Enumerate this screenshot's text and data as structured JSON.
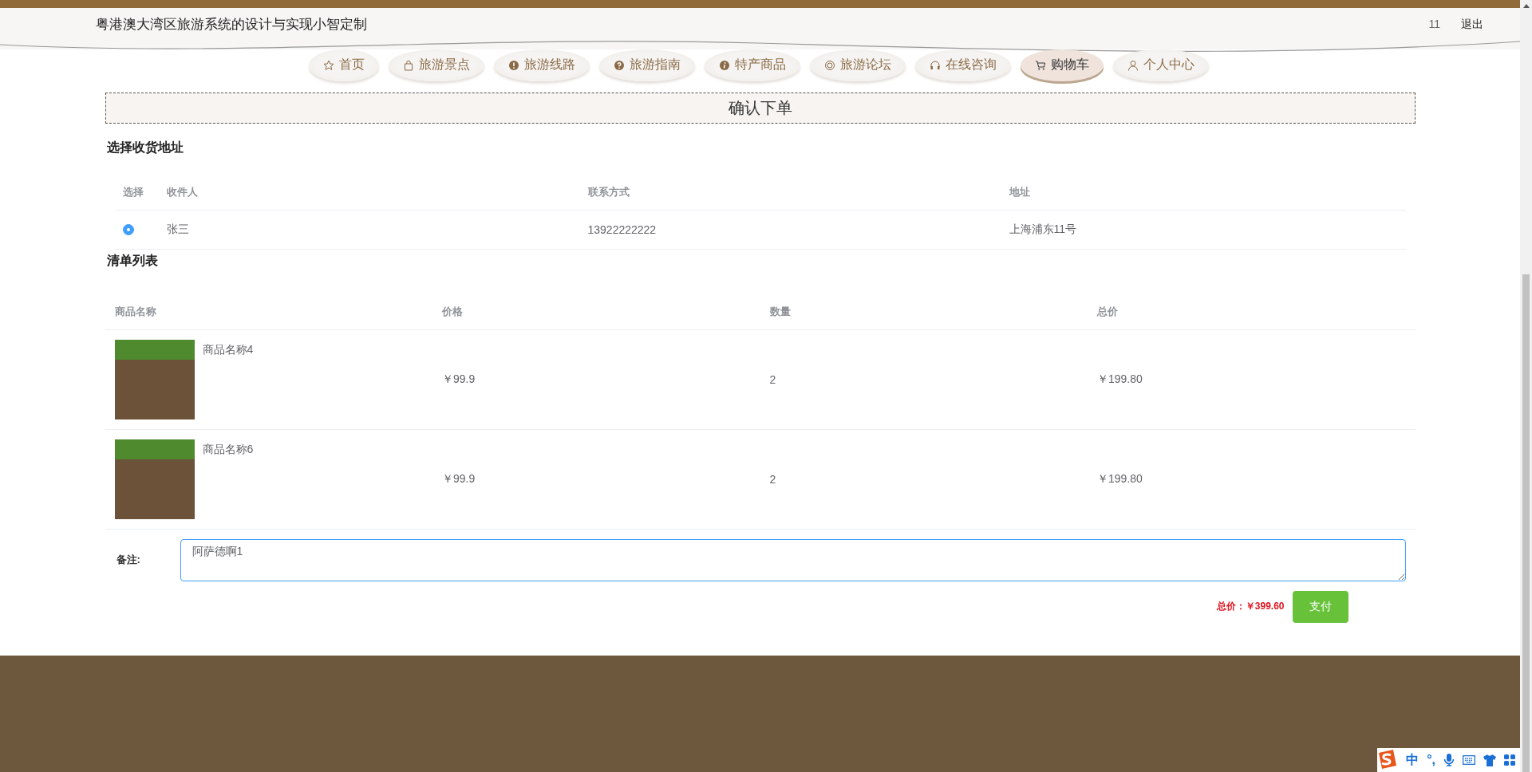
{
  "header": {
    "title": "粤港澳大湾区旅游系统的设计与实现小智定制",
    "user": "11",
    "logout": "退出"
  },
  "nav": [
    {
      "label": "首页",
      "selected": false
    },
    {
      "label": "旅游景点",
      "selected": false
    },
    {
      "label": "旅游线路",
      "selected": false
    },
    {
      "label": "旅游指南",
      "selected": false
    },
    {
      "label": "特产商品",
      "selected": false
    },
    {
      "label": "旅游论坛",
      "selected": false
    },
    {
      "label": "在线咨询",
      "selected": false
    },
    {
      "label": "购物车",
      "selected": true
    },
    {
      "label": "个人中心",
      "selected": false
    }
  ],
  "banner": {
    "title": "确认下单"
  },
  "address_section": {
    "heading": "选择收货地址",
    "columns": [
      "选择",
      "收件人",
      "联系方式",
      "地址"
    ],
    "rows": [
      {
        "selected": true,
        "name": "张三",
        "phone": "13922222222",
        "address": "上海浦东11号"
      }
    ]
  },
  "items_section": {
    "heading": "清单列表",
    "columns": [
      "商品名称",
      "价格",
      "数量",
      "总价"
    ],
    "rows": [
      {
        "name": "商品名称4",
        "price": "￥99.9",
        "quantity": "2",
        "total": "￥199.80"
      },
      {
        "name": "商品名称6",
        "price": "￥99.9",
        "quantity": "2",
        "total": "￥199.80"
      }
    ]
  },
  "remark": {
    "label": "备注:",
    "value": "阿萨德啊1"
  },
  "summary": {
    "total": "总价：￥399.60",
    "pay_button": "支付"
  },
  "ime_toolbar": {
    "mode": "中",
    "punctuation": "°,"
  }
}
